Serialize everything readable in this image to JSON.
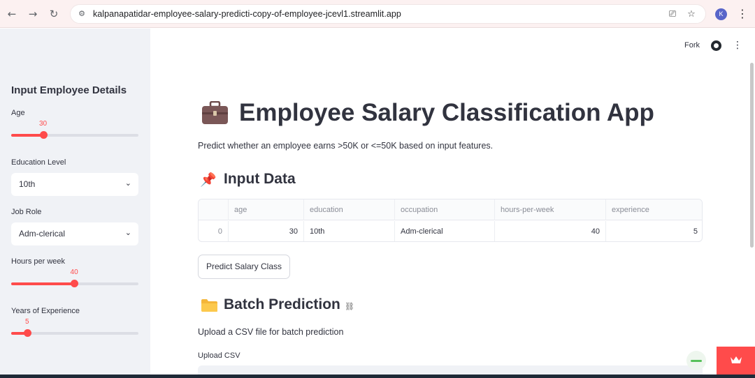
{
  "browser": {
    "url": "kalpanapatidar-employee-salary-predicti-copy-of-employee-jcevl1.streamlit.app",
    "profile_initial": "K",
    "icons": [
      "back-arrow-icon",
      "forward-arrow-icon",
      "reload-icon",
      "site-info-icon",
      "install-app-icon",
      "bookmark-star-icon",
      "more-vert-icon"
    ]
  },
  "toolbar": {
    "fork_label": "Fork",
    "icons": [
      "github-icon",
      "main-menu-icon"
    ]
  },
  "sidebar": {
    "title": "Input Employee Details",
    "age": {
      "label": "Age",
      "value": "30",
      "fraction": 0.25
    },
    "education": {
      "label": "Education Level",
      "selected": "10th"
    },
    "job_role": {
      "label": "Job Role",
      "selected": "Adm-clerical"
    },
    "hours": {
      "label": "Hours per week",
      "value": "40",
      "fraction": 0.495
    },
    "experience": {
      "label": "Years of Experience",
      "value": "5",
      "fraction": 0.125
    }
  },
  "main": {
    "title": "Employee Salary Classification App",
    "title_icon": "briefcase-icon",
    "subtitle": "Predict whether an employee earns >50K or <=50K based on input features.",
    "input_section": {
      "emoji": "📌",
      "title": "Input Data"
    },
    "table": {
      "columns": [
        "age",
        "education",
        "occupation",
        "hours-per-week",
        "experience"
      ],
      "rows": [
        {
          "index": "0",
          "cells": [
            "30",
            "10th",
            "Adm-clerical",
            "40",
            "5"
          ]
        }
      ]
    },
    "predict_button": "Predict Salary Class",
    "batch_section": {
      "title": "Batch Prediction",
      "icon": "folder-icon"
    },
    "batch_text": "Upload a CSV file for batch prediction",
    "upload_label": "Upload CSV"
  },
  "colors": {
    "accent": "#ff4b4b",
    "sidebar_bg": "#f0f2f6",
    "text": "#31333f"
  }
}
